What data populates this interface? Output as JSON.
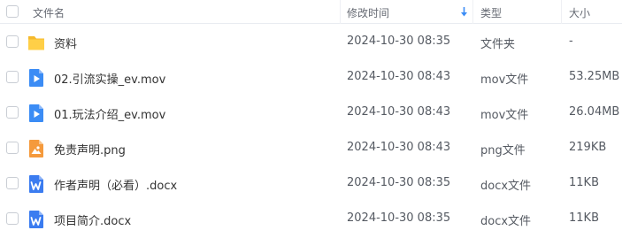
{
  "columns": {
    "name": "文件名",
    "modified": "修改时间",
    "type": "类型",
    "size": "大小"
  },
  "accent": "#3b8cf5",
  "rows": [
    {
      "name": "资料",
      "modified": "2024-10-30 08:35",
      "type": "文件夹",
      "size": "-",
      "icon": "folder-icon"
    },
    {
      "name": "02.引流实操_ev.mov",
      "modified": "2024-10-30 08:43",
      "type": "mov文件",
      "size": "53.25MB",
      "icon": "video-file-icon"
    },
    {
      "name": "01.玩法介绍_ev.mov",
      "modified": "2024-10-30 08:43",
      "type": "mov文件",
      "size": "26.04MB",
      "icon": "video-file-icon"
    },
    {
      "name": "免责声明.png",
      "modified": "2024-10-30 08:43",
      "type": "png文件",
      "size": "219KB",
      "icon": "image-file-icon"
    },
    {
      "name": "作者声明（必看）.docx",
      "modified": "2024-10-30 08:35",
      "type": "docx文件",
      "size": "11KB",
      "icon": "word-file-icon"
    },
    {
      "name": "项目简介.docx",
      "modified": "2024-10-30 08:35",
      "type": "docx文件",
      "size": "11KB",
      "icon": "word-file-icon"
    }
  ]
}
